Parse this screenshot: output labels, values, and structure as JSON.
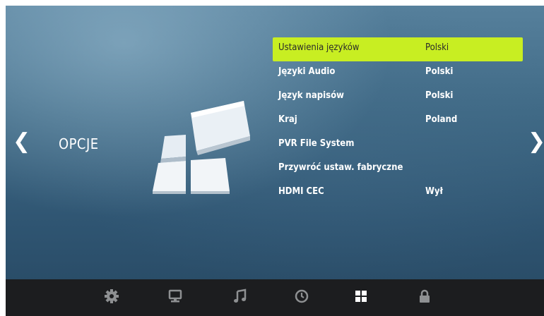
{
  "nav": {
    "prev_glyph": "❮",
    "next_glyph": "❯"
  },
  "section": {
    "title": "OPCJE",
    "icon": "options-tiles-icon"
  },
  "menu": {
    "selected_index": 0,
    "highlight_color": "#c8ee22",
    "items": [
      {
        "label": "Ustawienia języków",
        "value": "Polski"
      },
      {
        "label": "Języki Audio",
        "value": "Polski"
      },
      {
        "label": "Język napisów",
        "value": "Polski"
      },
      {
        "label": "Kraj",
        "value": "Poland"
      },
      {
        "label": "PVR File System",
        "value": ""
      },
      {
        "label": "Przywróć ustaw. fabryczne",
        "value": ""
      },
      {
        "label": "HDMI CEC",
        "value": "Wył"
      }
    ]
  },
  "taskbar": {
    "icons": [
      "settings-gear-icon",
      "monitor-icon",
      "music-note-icon",
      "clock-icon",
      "options-grid-icon",
      "lock-icon"
    ],
    "active_icon": "options-grid-icon"
  }
}
